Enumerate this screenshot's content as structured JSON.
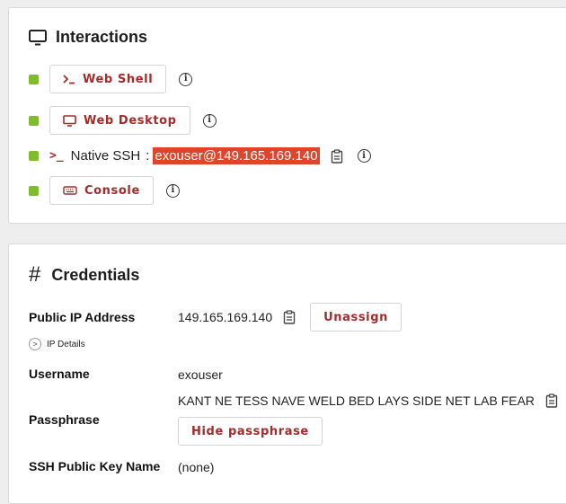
{
  "interactions": {
    "title": "Interactions",
    "web_shell_label": "Web Shell",
    "web_desktop_label": "Web Desktop",
    "native_ssh_prompt": ">_",
    "native_ssh_label": "Native SSH",
    "native_ssh_sep": ":",
    "native_ssh_command": "exouser@149.165.169.140",
    "console_label": "Console",
    "info_glyph": "i"
  },
  "credentials": {
    "title": "Credentials",
    "public_ip_label": "Public IP Address",
    "public_ip_value": "149.165.169.140",
    "unassign_label": "Unassign",
    "ip_details_label": "IP Details",
    "username_label": "Username",
    "username_value": "exouser",
    "passphrase_label": "Passphrase",
    "passphrase_value": "KANT NE TESS NAVE WELD BED LAYS SIDE NET LAB FEAR",
    "hide_passphrase_label": "Hide passphrase",
    "ssh_key_label": "SSH Public Key Name",
    "ssh_key_value": "(none)"
  },
  "colors": {
    "accent": "#a52a2a",
    "status_green": "#7fbb2c",
    "highlight": "#e0452b"
  }
}
